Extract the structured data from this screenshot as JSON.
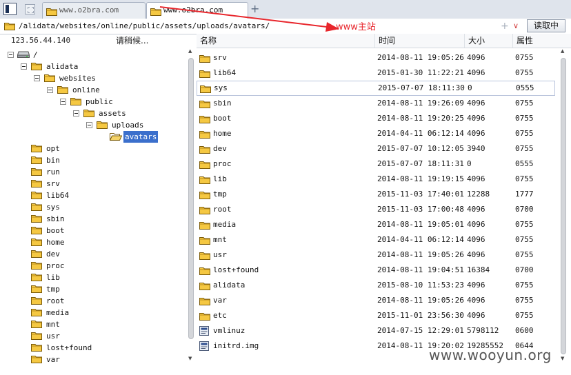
{
  "tabs": [
    {
      "label": "www.o2bra.com",
      "active": false
    },
    {
      "label": "www.o2bra.com",
      "active": true
    }
  ],
  "icons": {
    "panel_toggle": "sidebar-toggle-icon",
    "blank_tab": "blank-page-icon",
    "add_tab": "+",
    "folder": "folder-icon",
    "file": "file-icon",
    "drive": "hard-drive-icon",
    "expander": "tree-expand-minus-icon"
  },
  "address": {
    "path": "/alidata/websites/online/public/assets/uploads/avatars/",
    "plus": "+",
    "dropdown": "∨",
    "read_button": "读取中"
  },
  "annotation": {
    "label": "www主站",
    "color": "#e8262c"
  },
  "status": {
    "ip": "123.56.44.140",
    "message": "请稍候..."
  },
  "tree": [
    {
      "label": "/",
      "type": "drive",
      "depth": 0,
      "expanded": true
    },
    {
      "label": "alidata",
      "type": "folder",
      "depth": 1,
      "expanded": true
    },
    {
      "label": "websites",
      "type": "folder",
      "depth": 2,
      "expanded": true
    },
    {
      "label": "online",
      "type": "folder",
      "depth": 3,
      "expanded": true
    },
    {
      "label": "public",
      "type": "folder",
      "depth": 4,
      "expanded": true
    },
    {
      "label": "assets",
      "type": "folder",
      "depth": 5,
      "expanded": true
    },
    {
      "label": "uploads",
      "type": "folder",
      "depth": 6,
      "expanded": true
    },
    {
      "label": "avatars",
      "type": "folder",
      "depth": 7,
      "expanded": false,
      "selected": true
    },
    {
      "label": "opt",
      "type": "folder",
      "depth": 1,
      "expanded": false
    },
    {
      "label": "bin",
      "type": "folder",
      "depth": 1,
      "expanded": false
    },
    {
      "label": "run",
      "type": "folder",
      "depth": 1,
      "expanded": false
    },
    {
      "label": "srv",
      "type": "folder",
      "depth": 1,
      "expanded": false
    },
    {
      "label": "lib64",
      "type": "folder",
      "depth": 1,
      "expanded": false
    },
    {
      "label": "sys",
      "type": "folder",
      "depth": 1,
      "expanded": false
    },
    {
      "label": "sbin",
      "type": "folder",
      "depth": 1,
      "expanded": false
    },
    {
      "label": "boot",
      "type": "folder",
      "depth": 1,
      "expanded": false
    },
    {
      "label": "home",
      "type": "folder",
      "depth": 1,
      "expanded": false
    },
    {
      "label": "dev",
      "type": "folder",
      "depth": 1,
      "expanded": false
    },
    {
      "label": "proc",
      "type": "folder",
      "depth": 1,
      "expanded": false
    },
    {
      "label": "lib",
      "type": "folder",
      "depth": 1,
      "expanded": false
    },
    {
      "label": "tmp",
      "type": "folder",
      "depth": 1,
      "expanded": false
    },
    {
      "label": "root",
      "type": "folder",
      "depth": 1,
      "expanded": false
    },
    {
      "label": "media",
      "type": "folder",
      "depth": 1,
      "expanded": false
    },
    {
      "label": "mnt",
      "type": "folder",
      "depth": 1,
      "expanded": false
    },
    {
      "label": "usr",
      "type": "folder",
      "depth": 1,
      "expanded": false
    },
    {
      "label": "lost+found",
      "type": "folder",
      "depth": 1,
      "expanded": false
    },
    {
      "label": "var",
      "type": "folder",
      "depth": 1,
      "expanded": false
    }
  ],
  "columns": {
    "name": "名称",
    "time": "时间",
    "size": "大小",
    "perm": "属性"
  },
  "files": [
    {
      "name": "srv",
      "type": "folder",
      "time": "2014-08-11 19:05:26",
      "size": "4096",
      "perm": "0755"
    },
    {
      "name": "lib64",
      "type": "folder",
      "time": "2015-01-30 11:22:21",
      "size": "4096",
      "perm": "0755"
    },
    {
      "name": "sys",
      "type": "folder",
      "time": "2015-07-07 18:11:30",
      "size": "0",
      "perm": "0555",
      "highlight": true
    },
    {
      "name": "sbin",
      "type": "folder",
      "time": "2014-08-11 19:26:09",
      "size": "4096",
      "perm": "0755"
    },
    {
      "name": "boot",
      "type": "folder",
      "time": "2014-08-11 19:20:25",
      "size": "4096",
      "perm": "0755"
    },
    {
      "name": "home",
      "type": "folder",
      "time": "2014-04-11 06:12:14",
      "size": "4096",
      "perm": "0755"
    },
    {
      "name": "dev",
      "type": "folder",
      "time": "2015-07-07 10:12:05",
      "size": "3940",
      "perm": "0755"
    },
    {
      "name": "proc",
      "type": "folder",
      "time": "2015-07-07 18:11:31",
      "size": "0",
      "perm": "0555"
    },
    {
      "name": "lib",
      "type": "folder",
      "time": "2014-08-11 19:19:15",
      "size": "4096",
      "perm": "0755"
    },
    {
      "name": "tmp",
      "type": "folder",
      "time": "2015-11-03 17:40:01",
      "size": "12288",
      "perm": "1777"
    },
    {
      "name": "root",
      "type": "folder",
      "time": "2015-11-03 17:00:48",
      "size": "4096",
      "perm": "0700"
    },
    {
      "name": "media",
      "type": "folder",
      "time": "2014-08-11 19:05:01",
      "size": "4096",
      "perm": "0755"
    },
    {
      "name": "mnt",
      "type": "folder",
      "time": "2014-04-11 06:12:14",
      "size": "4096",
      "perm": "0755"
    },
    {
      "name": "usr",
      "type": "folder",
      "time": "2014-08-11 19:05:26",
      "size": "4096",
      "perm": "0755"
    },
    {
      "name": "lost+found",
      "type": "folder",
      "time": "2014-08-11 19:04:51",
      "size": "16384",
      "perm": "0700"
    },
    {
      "name": "alidata",
      "type": "folder",
      "time": "2015-08-10 11:53:23",
      "size": "4096",
      "perm": "0755"
    },
    {
      "name": "var",
      "type": "folder",
      "time": "2014-08-11 19:05:26",
      "size": "4096",
      "perm": "0755"
    },
    {
      "name": "etc",
      "type": "folder",
      "time": "2015-11-01 23:56:30",
      "size": "4096",
      "perm": "0755"
    },
    {
      "name": "vmlinuz",
      "type": "file",
      "time": "2014-07-15 12:29:01",
      "size": "5798112",
      "perm": "0600"
    },
    {
      "name": "initrd.img",
      "type": "file",
      "time": "2014-08-11 19:20:02",
      "size": "19285552",
      "perm": "0644"
    }
  ],
  "watermark": "www.wooyun.org",
  "colors": {
    "selection": "#3b6fcc",
    "folder": "#f5c842",
    "annotation": "#e8262c"
  }
}
